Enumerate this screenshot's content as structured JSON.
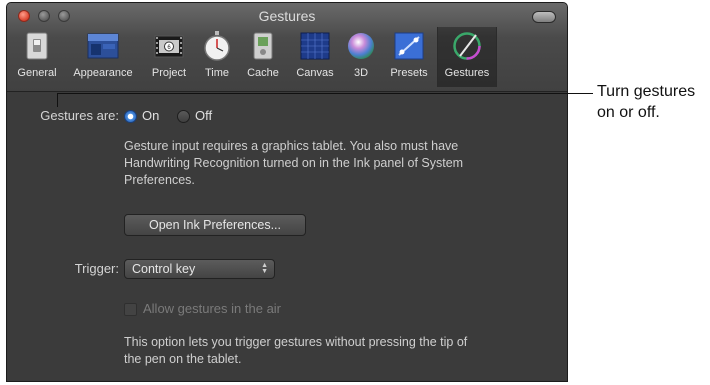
{
  "window": {
    "title": "Gestures"
  },
  "toolbar": {
    "items": [
      {
        "label": "General",
        "icon": "switch-icon"
      },
      {
        "label": "Appearance",
        "icon": "appearance-icon"
      },
      {
        "label": "Project",
        "icon": "film-project-icon"
      },
      {
        "label": "Time",
        "icon": "stopwatch-icon"
      },
      {
        "label": "Cache",
        "icon": "cache-icon"
      },
      {
        "label": "Canvas",
        "icon": "canvas-grid-icon"
      },
      {
        "label": "3D",
        "icon": "sphere-3d-icon"
      },
      {
        "label": "Presets",
        "icon": "presets-icon"
      },
      {
        "label": "Gestures",
        "icon": "gestures-icon",
        "selected": true
      }
    ]
  },
  "gestures": {
    "label": "Gestures are:",
    "options": [
      "On",
      "Off"
    ],
    "selected": "On",
    "description_lines": [
      "Gesture input requires a graphics tablet. You also must have",
      "Handwriting Recognition turned on in the Ink panel of System",
      "Preferences."
    ],
    "open_ink_button": "Open Ink Preferences..."
  },
  "trigger": {
    "label": "Trigger:",
    "value": "Control key"
  },
  "air": {
    "checkbox_label": "Allow gestures in the air",
    "checked": false,
    "enabled": false
  },
  "option_note_lines": [
    "This option lets you trigger gestures without pressing the tip of",
    "the pen on the tablet."
  ],
  "callout": {
    "lines": [
      "Turn gestures",
      "on or off."
    ]
  },
  "colors": {
    "accent": "#3a7bd5",
    "window_bg": "#3b3b3b"
  }
}
